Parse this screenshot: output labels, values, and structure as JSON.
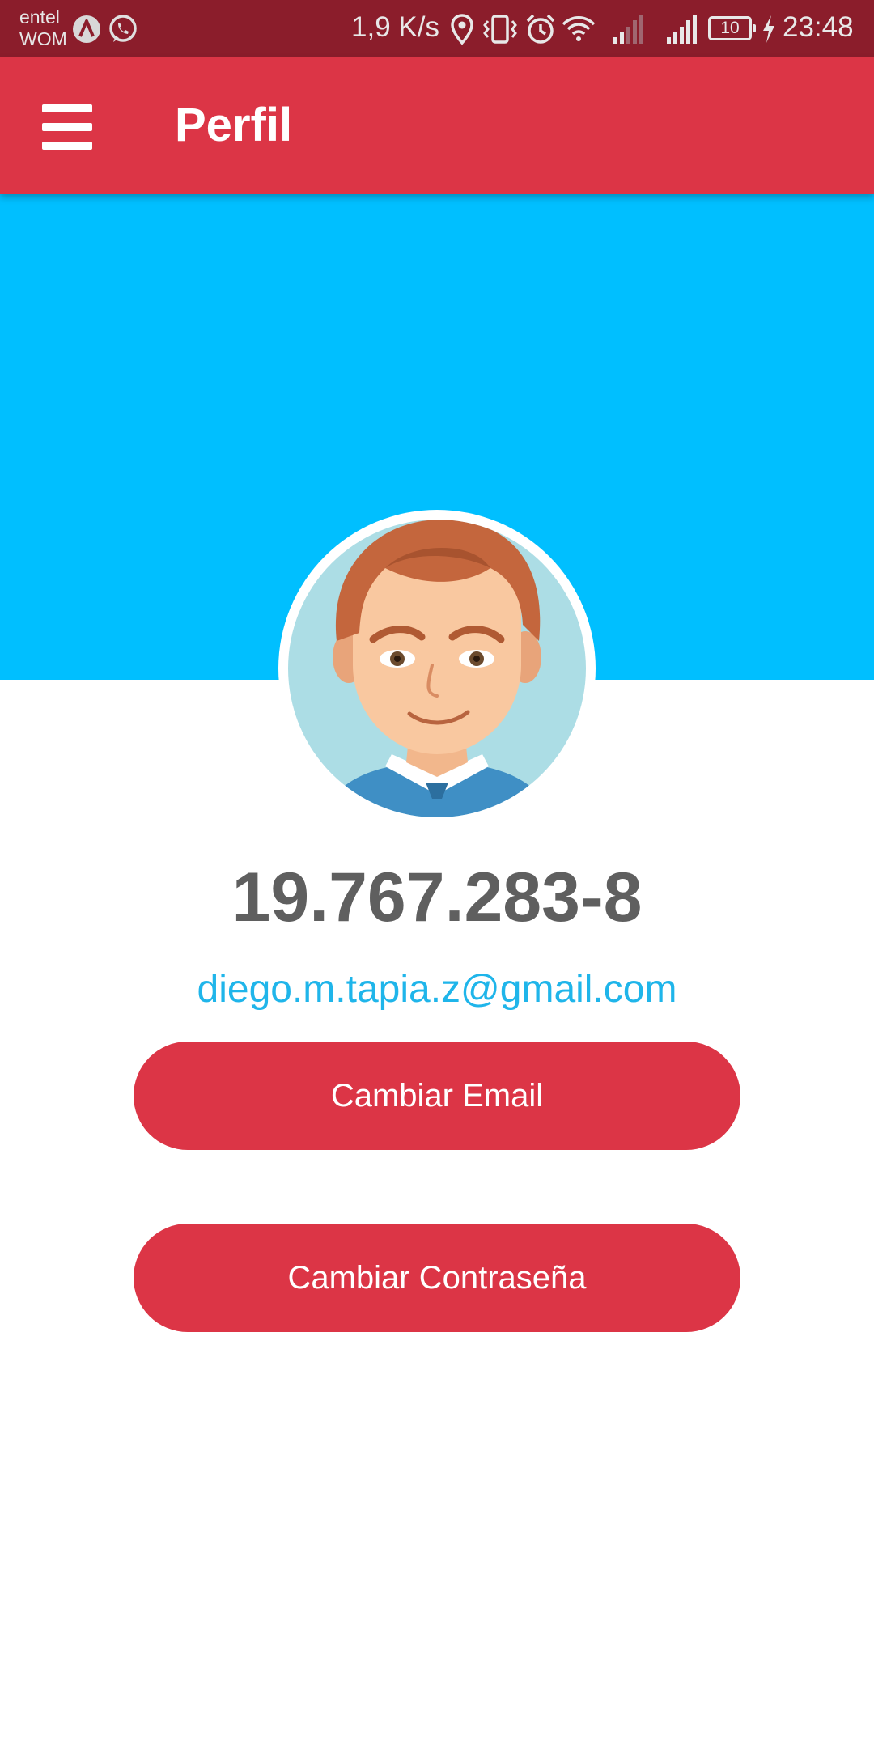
{
  "status_bar": {
    "carriers": [
      "entel",
      "WOM"
    ],
    "net_speed": "1,9 K/s",
    "battery_level": "10",
    "time": "23:48",
    "icons": [
      "app-a-icon",
      "whatsapp-icon",
      "location-icon",
      "vibrate-icon",
      "alarm-icon",
      "wifi-icon",
      "signal-icon",
      "signal-icon",
      "battery-icon",
      "charging-icon"
    ]
  },
  "app_bar": {
    "title": "Perfil",
    "menu_icon": "hamburger-menu-icon",
    "color": "#dc3546"
  },
  "profile": {
    "cover_color": "#00bfff",
    "avatar": "cartoon-man-avatar",
    "user_id": "19.767.283-8",
    "email": "diego.m.tapia.z@gmail.com"
  },
  "actions": {
    "change_email_label": "Cambiar Email",
    "change_password_label": "Cambiar Contraseña"
  }
}
